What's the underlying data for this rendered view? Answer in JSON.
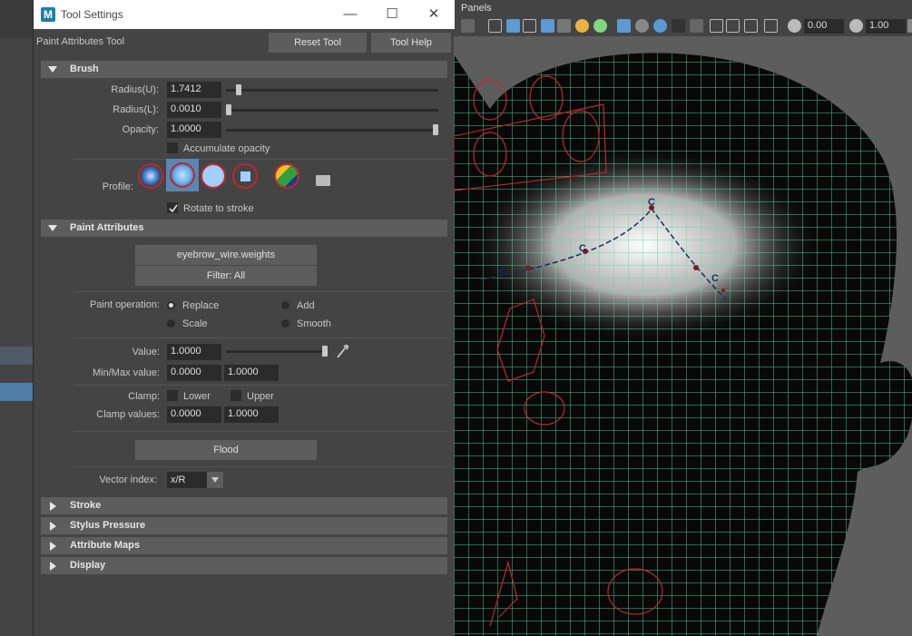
{
  "window": {
    "title": "Tool Settings",
    "app_icon_letter": "M",
    "minimize_glyph": "—",
    "maximize_glyph": "☐",
    "close_glyph": "✕"
  },
  "tool": {
    "name": "Paint Attributes Tool",
    "reset_label": "Reset Tool",
    "help_label": "Tool Help"
  },
  "brush": {
    "header": "Brush",
    "radius_u_label": "Radius(U):",
    "radius_u_value": "1.7412",
    "radius_l_label": "Radius(L):",
    "radius_l_value": "0.0010",
    "opacity_label": "Opacity:",
    "opacity_value": "1.0000",
    "accumulate_label": "Accumulate opacity",
    "profile_label": "Profile:",
    "rotate_label": "Rotate to stroke",
    "rotate_checked": true,
    "radius_u_fraction": 0.05,
    "radius_l_fraction": 0.0,
    "opacity_fraction": 1.0
  },
  "paint_attributes": {
    "header": "Paint Attributes",
    "attribute_button": "eyebrow_wire.weights",
    "filter_button": "Filter: All",
    "operation_label": "Paint operation:",
    "operations": [
      "Replace",
      "Add",
      "Scale",
      "Smooth"
    ],
    "selected_operation": "Replace",
    "value_label": "Value:",
    "value": "1.0000",
    "value_fraction": 1.0,
    "minmax_label": "Min/Max value:",
    "min_value": "0.0000",
    "max_value": "1.0000",
    "clamp_label": "Clamp:",
    "clamp_lower": "Lower",
    "clamp_upper": "Upper",
    "clamp_values_label": "Clamp values:",
    "clamp_min": "0.0000",
    "clamp_max": "1.0000",
    "flood_label": "Flood",
    "vector_index_label": "Vector index:",
    "vector_index_value": "x/R"
  },
  "collapsed_sections": [
    "Stroke",
    "Stylus Pressure",
    "Attribute Maps",
    "Display"
  ],
  "viewport": {
    "menu_panels": "Panels",
    "field_1": "0.00",
    "field_2": "1.00",
    "curve_labels": [
      "C",
      "C",
      "C",
      "C"
    ]
  },
  "colors": {
    "panel_bg": "#444444",
    "header_bg": "#5d5d5d",
    "field_bg": "#2b2b2b",
    "wire_green": "#54e0a0",
    "curve_red": "#c0282e",
    "curve_navy": "#1a2a5a"
  }
}
